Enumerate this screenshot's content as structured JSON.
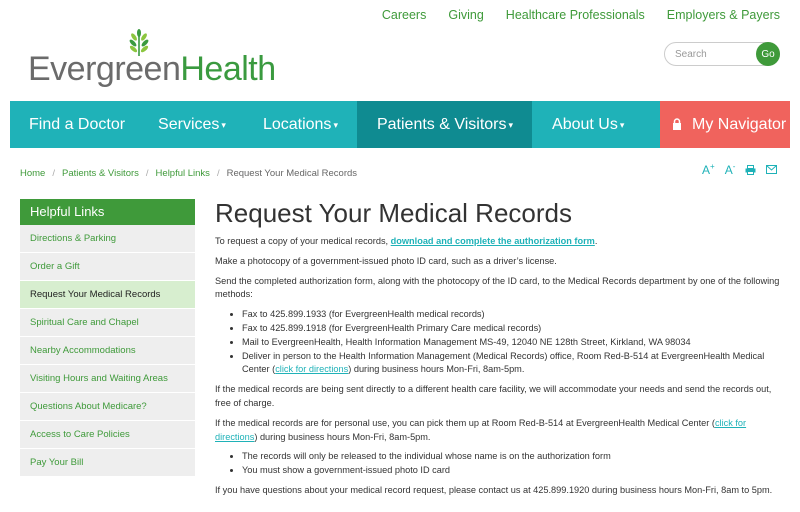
{
  "util_links": [
    "Careers",
    "Giving",
    "Healthcare Professionals",
    "Employers & Payers"
  ],
  "logo": {
    "part1": "Evergreen",
    "part2": "Health"
  },
  "search": {
    "placeholder": "Search",
    "button": "Go"
  },
  "nav": {
    "find_doctor": "Find a Doctor",
    "services": "Services",
    "locations": "Locations",
    "patients": "Patients & Visitors",
    "about": "About Us",
    "my_navigator": "My Navigator",
    "caret": "▾"
  },
  "breadcrumb": {
    "home": "Home",
    "patients": "Patients & Visitors",
    "helpful": "Helpful Links",
    "current": "Request Your Medical Records",
    "sep": "/"
  },
  "tools": {
    "increase": "A",
    "decrease": "A",
    "plus": "+",
    "minus": "-"
  },
  "sidebar": {
    "heading": "Helpful Links",
    "items": [
      "Directions & Parking",
      "Order a Gift",
      "Request Your Medical Records",
      "Spiritual Care and Chapel",
      "Nearby Accommodations",
      "Visiting Hours and Waiting Areas",
      "Questions About Medicare?",
      "Access to Care Policies",
      "Pay Your Bill"
    ]
  },
  "content": {
    "title": "Request Your Medical Records",
    "p1_pre": "To request a copy of your medical records, ",
    "p1_link": "download and complete the authorization form",
    "p1_post": ".",
    "p2": "Make a photocopy of a government-issued photo ID card, such as a driver’s license.",
    "p3": "Send the completed authorization form, along with the photocopy of the ID card, to the Medical Records department by one of the following methods:",
    "methods": [
      "Fax to 425.899.1933 (for EvergreenHealth medical records)",
      "Fax to 425.899.1918 (for EvergreenHealth Primary Care medical records)",
      "Mail to EvergreenHealth, Health Information Management MS-49, 12040 NE 128th Street, Kirkland, WA 98034"
    ],
    "method4_pre": "Deliver in person to the Health Information Management (Medical Records) office, Room Red-B-514 at EvergreenHealth Medical Center (",
    "method4_link": "click for directions",
    "method4_post": ") during business hours Mon-Fri, 8am-5pm.",
    "p4": "If the medical records are being sent directly to a different health care facility, we will accommodate your needs and send the records out, free of charge.",
    "p5_pre": "If the medical records are for personal use, you can pick them up at Room Red-B-514 at EvergreenHealth Medical Center (",
    "p5_link": "click for directions",
    "p5_post": ") during business hours Mon-Fri, 8am-5pm.",
    "notes": [
      "The records will only be released to the individual whose name is on the authorization form",
      "You must show a government-issued photo ID card"
    ],
    "p6": "If you have questions about your medical record request, please contact us at 425.899.1920 during business hours Mon-Fri, 8am to 5pm."
  },
  "colors": {
    "green": "#3f9a3a",
    "teal": "#1fb2b8",
    "teal_dark": "#0f8b91",
    "coral": "#f0635d"
  }
}
